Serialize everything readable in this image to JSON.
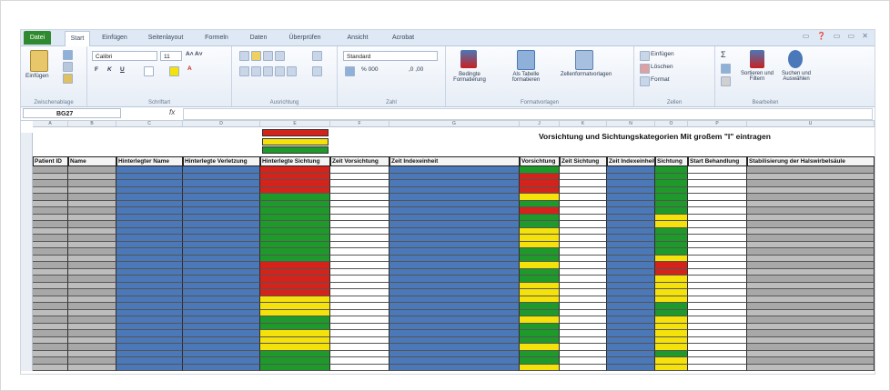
{
  "ribbon": {
    "tabs": [
      "Datei",
      "Start",
      "Einfügen",
      "Seitenlayout",
      "Formeln",
      "Daten",
      "Überprüfen",
      "Ansicht",
      "Acrobat"
    ],
    "clipboard": {
      "paste": "Einfügen",
      "label": "Zwischenablage"
    },
    "font": {
      "name": "Calibri",
      "size": "11",
      "label": "Schriftart"
    },
    "alignment": {
      "label": "Ausrichtung"
    },
    "number": {
      "format": "Standard",
      "label": "Zahl"
    },
    "styles": {
      "conditional": "Bedingte Formatierung",
      "table": "Als Tabelle formatieren",
      "cellstyles": "Zellenformatvorlagen",
      "label": "Formatvorlagen"
    },
    "cells": {
      "insert": "Einfügen",
      "delete": "Löschen",
      "format": "Format",
      "label": "Zellen"
    },
    "editing": {
      "sort": "Sortieren und Filtern",
      "find": "Suchen und Auswählen",
      "label": "Bearbeiten"
    }
  },
  "formula_bar": {
    "cell_ref": "BG27",
    "fx": "fx",
    "content": ""
  },
  "sheet": {
    "title": "Vorsichtung und Sichtungskategorien Mit großem \"I\" eintragen",
    "columns": [
      "Patient ID",
      "Name",
      "Hinterlegter Name",
      "Hinterlegte Verletzung",
      "Hinterlegte Sichtung",
      "Zeit Vorsichtung",
      "Zeit Indexeinheit",
      "Vorsichtung",
      "Zeit Sichtung",
      "Zeit Indexeinheit",
      "Sichtung",
      "Start Behandlung",
      "Stabilisierung der Halswirbelsäule"
    ],
    "column_letters": [
      "A",
      "B",
      "C",
      "D",
      "E",
      "F",
      "G",
      "J",
      "K",
      "N",
      "O",
      "P",
      "U"
    ]
  },
  "colors": {
    "red": "#d4231b",
    "yellow": "#f5e20a",
    "green": "#1e9a2a",
    "blue": "#4a78b8",
    "gray": "#a8a8a8",
    "accent": "#2f8a2f"
  }
}
